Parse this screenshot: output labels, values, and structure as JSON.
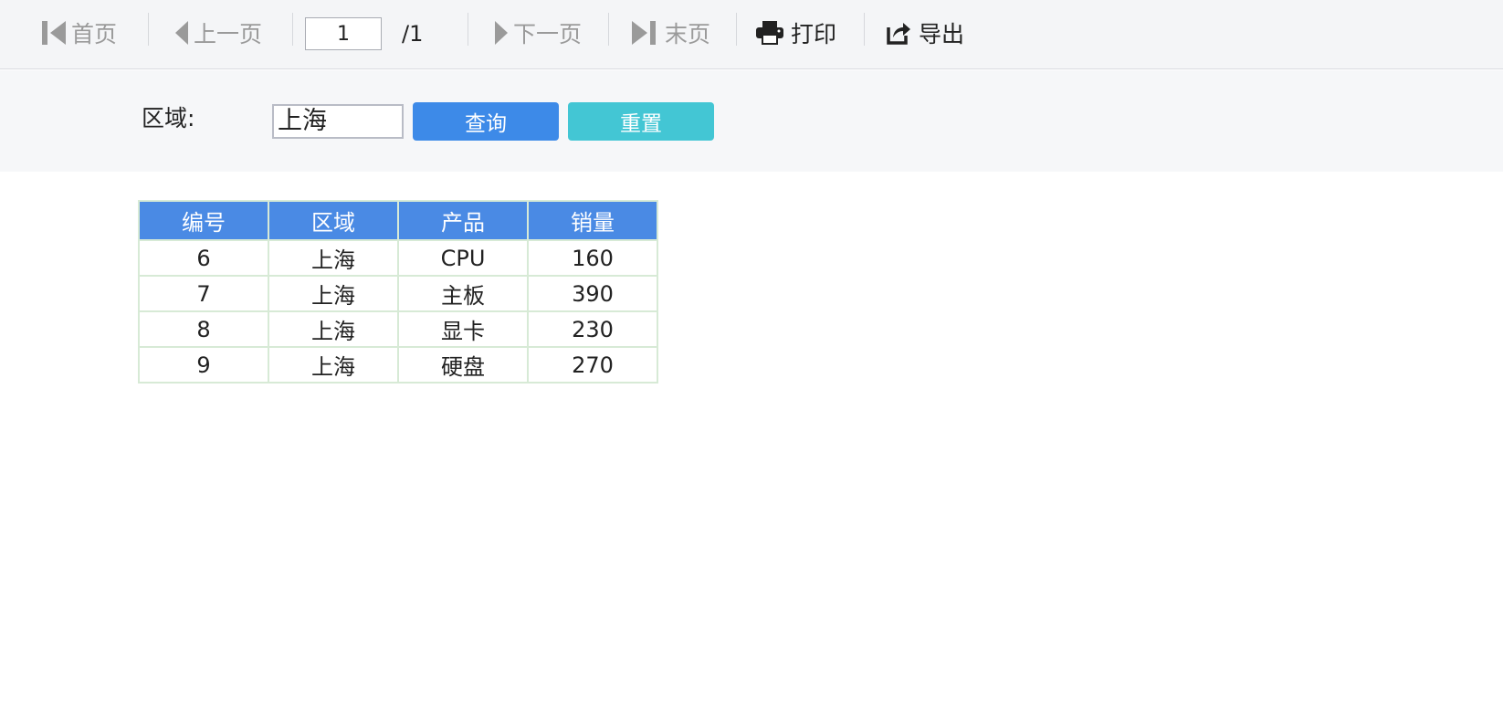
{
  "toolbar": {
    "first": "首页",
    "prev": "上一页",
    "page_current": "1",
    "page_total": "/1",
    "next": "下一页",
    "last": "末页",
    "print": "打印",
    "export": "导出"
  },
  "query": {
    "region_label": "区域:",
    "region_value": "上海",
    "query_button": "查询",
    "reset_button": "重置"
  },
  "table": {
    "headers": [
      "编号",
      "区域",
      "产品",
      "销量"
    ],
    "rows": [
      [
        "6",
        "上海",
        "CPU",
        "160"
      ],
      [
        "7",
        "上海",
        "主板",
        "390"
      ],
      [
        "8",
        "上海",
        "显卡",
        "230"
      ],
      [
        "9",
        "上海",
        "硬盘",
        "270"
      ]
    ]
  },
  "colors": {
    "header_bg": "#4a8ae4",
    "query_button": "#3d8ae8",
    "reset_button": "#43c6d4",
    "table_border": "#d7ead6"
  }
}
